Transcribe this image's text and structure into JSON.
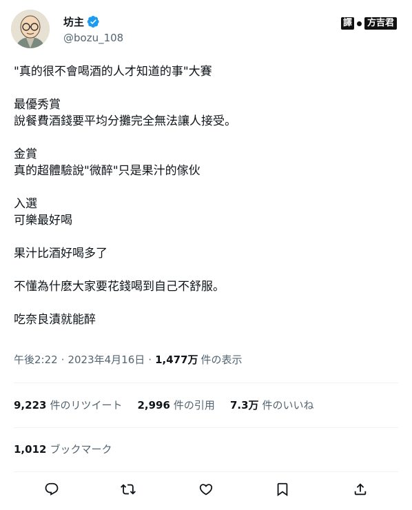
{
  "user": {
    "display_name": "坊主",
    "handle": "@bozu_108",
    "verified": true
  },
  "translator_badge": {
    "mark": "譯",
    "name": "方吉君"
  },
  "tweet": {
    "paragraphs": [
      "\"真的很不會喝酒的人才知道的事\"大賽",
      "最優秀賞\n說餐費酒錢要平均分攤完全無法讓人接受。",
      "金賞\n真的超體驗說\"微醉\"只是果汁的傢伙",
      "入選\n可樂最好喝",
      "果汁比酒好喝多了",
      "不懂為什麽大家要花錢喝到自己不舒服。",
      "吃奈良漬就能醉"
    ]
  },
  "meta": {
    "time": "午後2:22",
    "separator": "·",
    "date": "2023年4月16日",
    "views_count": "1,477万",
    "views_label": "件の表示"
  },
  "stats": {
    "retweets_count": "9,223",
    "retweets_label": "件のリツイート",
    "quotes_count": "2,996",
    "quotes_label": "件の引用",
    "likes_count": "7.3万",
    "likes_label": "件のいいね",
    "bookmarks_count": "1,012",
    "bookmarks_label": "ブックマーク"
  },
  "actions": [
    "reply-icon",
    "retweet-icon",
    "like-icon",
    "bookmark-icon",
    "share-icon"
  ],
  "colors": {
    "text": "#0f1419",
    "secondary": "#536471",
    "verified": "#1d9bf0",
    "divider": "#eff3f4"
  }
}
